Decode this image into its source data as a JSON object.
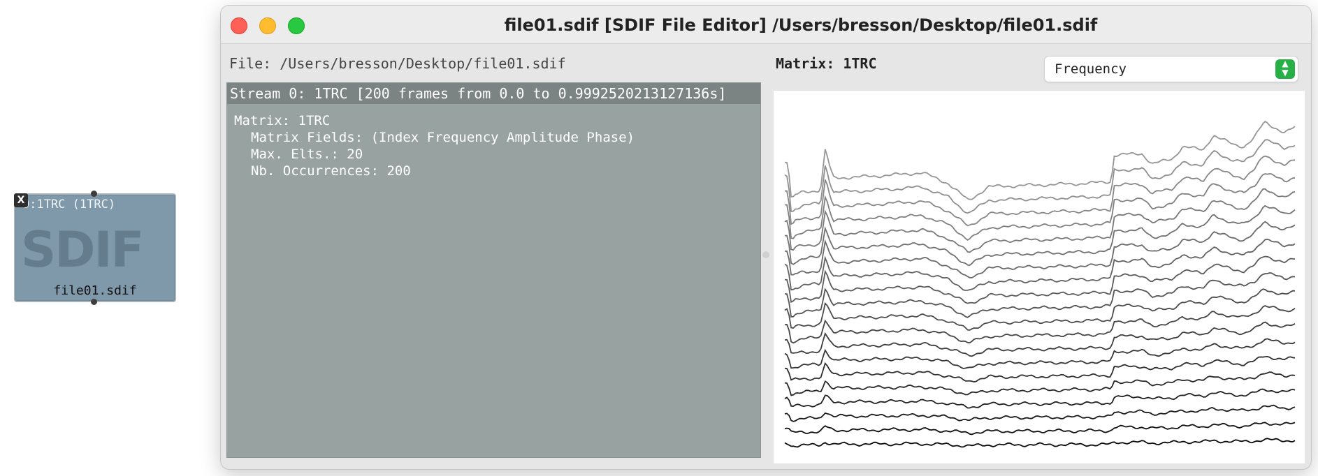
{
  "patch_box": {
    "label": "0:1TRC (1TRC)",
    "close_glyph": "X",
    "watermark": "SDIF",
    "filename": "file01.sdif"
  },
  "window": {
    "title": "file01.sdif [SDIF File Editor] /Users/bresson/Desktop/file01.sdif",
    "file_path": "File: /Users/bresson/Desktop/file01.sdif",
    "stream_header": "Stream 0: 1TRC [200 frames from 0.0 to 0.9992520213127136s]",
    "matrix_info": {
      "line1": "Matrix: 1TRC",
      "line2": "Matrix Fields: (Index Frequency Amplitude Phase)",
      "line3": "Max. Elts.: 20",
      "line4": "Nb. Occurrences: 200"
    },
    "matrix_title": "Matrix: 1TRC",
    "field_select": {
      "value": "Frequency",
      "icon": "up-down-chevron-icon"
    }
  },
  "colors": {
    "left_panel": "#98a2a1",
    "stream_header": "#7c8483",
    "patch_box": "#7f99ab",
    "select_accent": "#27b046",
    "traffic_red": "#fe5f57",
    "traffic_yellow": "#febc2e",
    "traffic_green": "#28c840"
  },
  "chart_data": {
    "type": "line",
    "description_field": "Frequency",
    "num_series": 20,
    "x_range": [
      0,
      1
    ],
    "trend_shape_x": [
      0.0,
      0.006,
      0.013,
      0.02,
      0.035,
      0.07,
      0.08,
      0.085,
      0.095,
      0.14,
      0.17,
      0.2,
      0.27,
      0.32,
      0.36,
      0.4,
      0.5,
      0.6,
      0.64,
      0.645,
      0.7,
      0.72,
      0.76,
      0.78,
      0.82,
      0.84,
      0.88,
      0.9,
      0.92,
      0.94,
      0.98,
      1.0
    ],
    "trend_shape_y": [
      0.55,
      0.55,
      0.1,
      0.16,
      0.2,
      0.22,
      0.72,
      0.55,
      0.36,
      0.37,
      0.38,
      0.39,
      0.42,
      0.3,
      0.1,
      0.26,
      0.28,
      0.3,
      0.32,
      0.62,
      0.64,
      0.52,
      0.58,
      0.72,
      0.68,
      0.85,
      0.74,
      0.72,
      0.82,
      1.0,
      0.88,
      0.94
    ]
  }
}
